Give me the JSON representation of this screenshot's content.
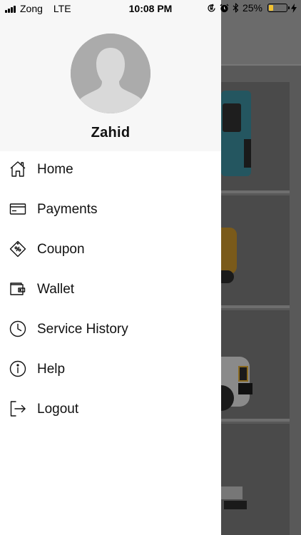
{
  "status_bar": {
    "carrier": "Zong",
    "network": "LTE",
    "time": "10:08 PM",
    "battery_percent": "25%",
    "battery_level": 0.25,
    "icons": [
      "signal-icon",
      "orientation-lock-icon",
      "alarm-icon",
      "bluetooth-icon",
      "battery-icon",
      "charging-icon"
    ]
  },
  "drawer": {
    "user_name": "Zahid",
    "avatar_icon": "default-avatar-icon",
    "menu": [
      {
        "label": "Home",
        "icon": "home-icon"
      },
      {
        "label": "Payments",
        "icon": "card-icon"
      },
      {
        "label": "Coupon",
        "icon": "coupon-icon"
      },
      {
        "label": "Wallet",
        "icon": "wallet-icon"
      },
      {
        "label": "Service History",
        "icon": "clock-icon"
      },
      {
        "label": "Help",
        "icon": "info-icon"
      },
      {
        "label": "Logout",
        "icon": "logout-icon"
      }
    ]
  },
  "colors": {
    "drawer_bg": "#ffffff",
    "header_bg": "#f7f7f7",
    "overlay_bg": "#595959",
    "text": "#111111",
    "battery_fill": "#f2c230"
  }
}
